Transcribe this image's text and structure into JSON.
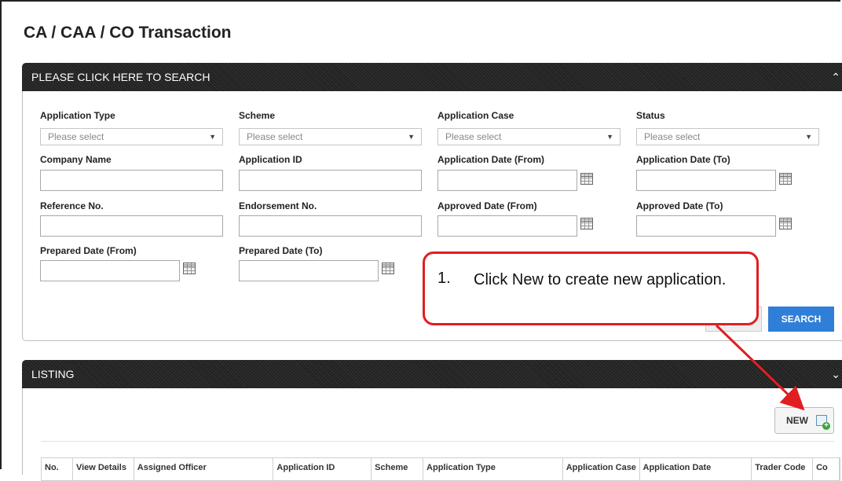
{
  "page": {
    "title": "CA / CAA / CO Transaction"
  },
  "search_panel": {
    "header": "PLEASE CLICK HERE TO SEARCH",
    "collapse_icon": "chevron-double-up-icon",
    "fields": {
      "application_type": {
        "label": "Application Type",
        "placeholder": "Please select"
      },
      "scheme": {
        "label": "Scheme",
        "placeholder": "Please select"
      },
      "application_case": {
        "label": "Application Case",
        "placeholder": "Please select"
      },
      "status": {
        "label": "Status",
        "placeholder": "Please select"
      },
      "company_name": {
        "label": "Company Name",
        "value": ""
      },
      "application_id": {
        "label": "Application ID",
        "value": ""
      },
      "application_date_from": {
        "label": "Application Date (From)",
        "value": ""
      },
      "application_date_to": {
        "label": "Application Date (To)",
        "value": ""
      },
      "reference_no": {
        "label": "Reference No.",
        "value": ""
      },
      "endorsement_no": {
        "label": "Endorsement No.",
        "value": ""
      },
      "approved_date_from": {
        "label": "Approved Date (From)",
        "value": ""
      },
      "approved_date_to": {
        "label": "Approved Date (To)",
        "value": ""
      },
      "prepared_date_from": {
        "label": "Prepared Date (From)",
        "value": ""
      },
      "prepared_date_to": {
        "label": "Prepared Date (To)",
        "value": ""
      }
    },
    "search_button": "SEARCH"
  },
  "callout": {
    "number": "1.",
    "text": "Click New to create new application.",
    "border_color": "#e01e22"
  },
  "listing_panel": {
    "header": "LISTING",
    "expand_icon": "chevron-double-down-icon",
    "new_button": "NEW",
    "new_icon": "new-document-icon",
    "columns": [
      "No.",
      "View Details",
      "Assigned Officer",
      "Application ID",
      "Scheme",
      "Application Type",
      "Application Case",
      "Application Date",
      "Trader Code",
      "Co"
    ]
  },
  "colors": {
    "search_button": "#2f7fd8",
    "header_bar": "#2a2a2a",
    "annotation": "#e01e22"
  }
}
